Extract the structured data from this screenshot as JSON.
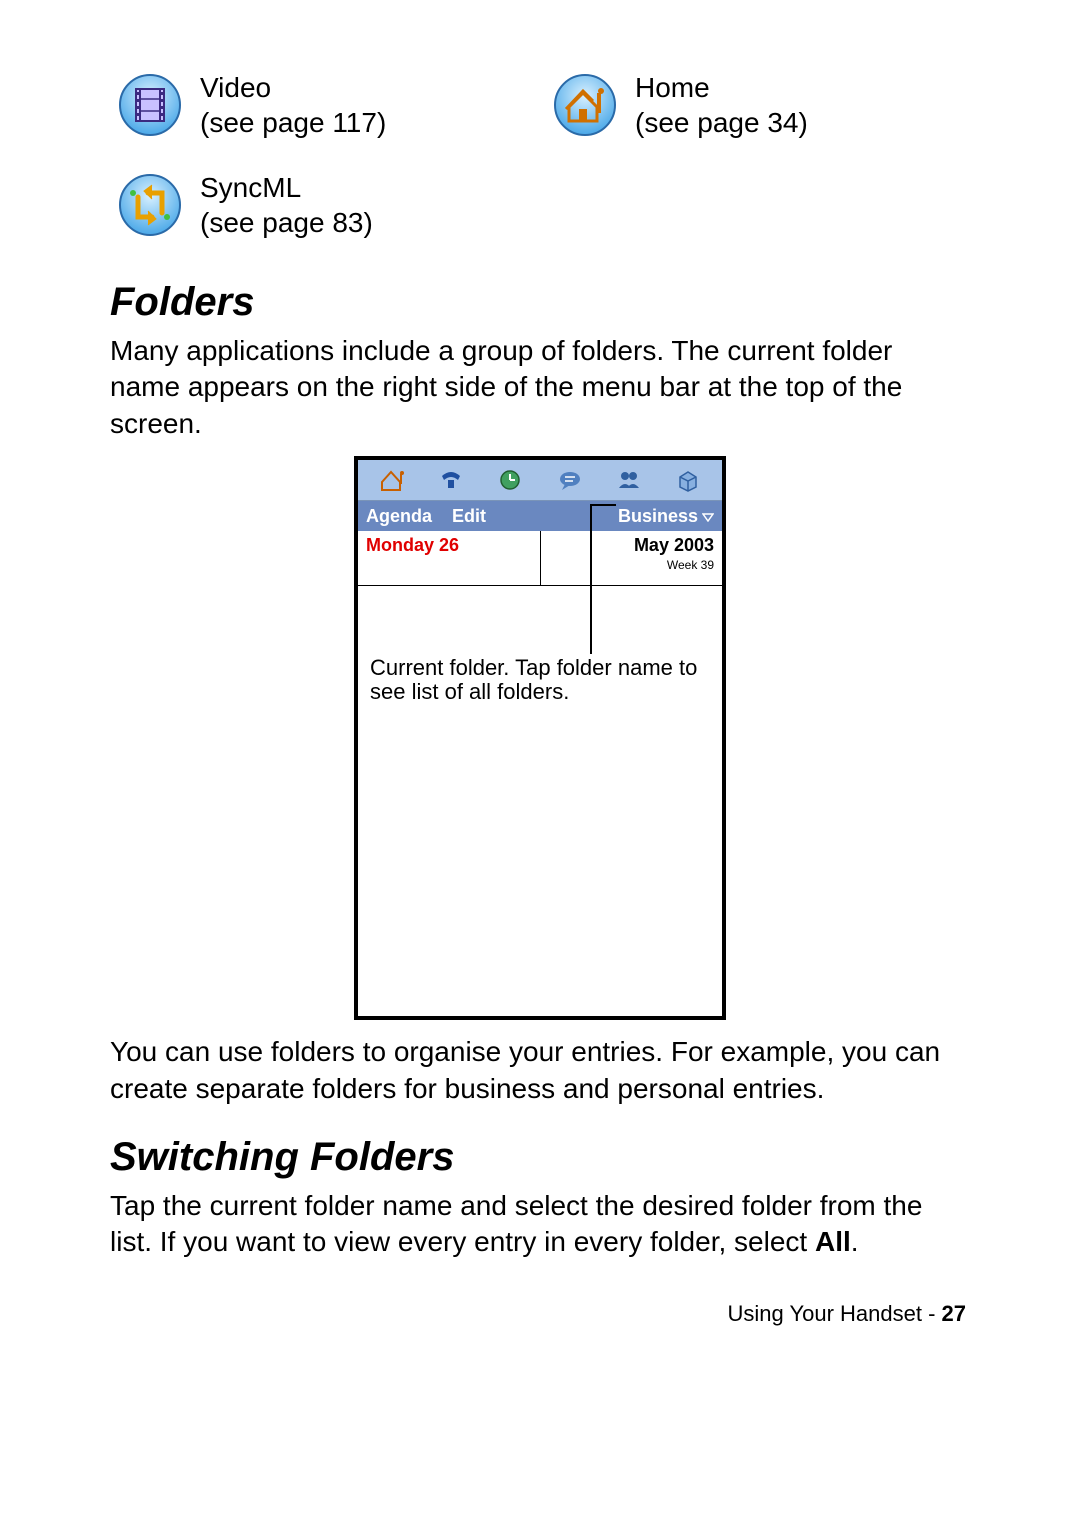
{
  "icons": {
    "video": {
      "title": "Video",
      "ref": "(see page 117)"
    },
    "home": {
      "title": "Home",
      "ref": "(see page 34)"
    },
    "syncml": {
      "title": "SyncML",
      "ref": "(see page 83)"
    }
  },
  "sections": {
    "folders_heading": "Folders",
    "folders_para1": "Many applications include a group of folders. The current folder name appears on the right side of the menu bar at the top of the screen.",
    "folders_para2_a": "You can use folders to organise your entries. For example, you can create separate folders for business and personal entries.",
    "switching_heading": "Switching Folders",
    "switching_para_a": "Tap the current folder name and select the desired folder from the list. If you want to view every entry in every folder, select ",
    "switching_para_bold": "All",
    "switching_para_b": "."
  },
  "device": {
    "menu": {
      "agenda": "Agenda",
      "edit": "Edit",
      "folder": "Business"
    },
    "date": {
      "day": "Monday 26",
      "month": "May 2003",
      "week": "Week 39"
    },
    "callout": "Current folder. Tap folder name to see list of all folders."
  },
  "footer": {
    "label": "Using Your Handset - ",
    "page": "27"
  }
}
